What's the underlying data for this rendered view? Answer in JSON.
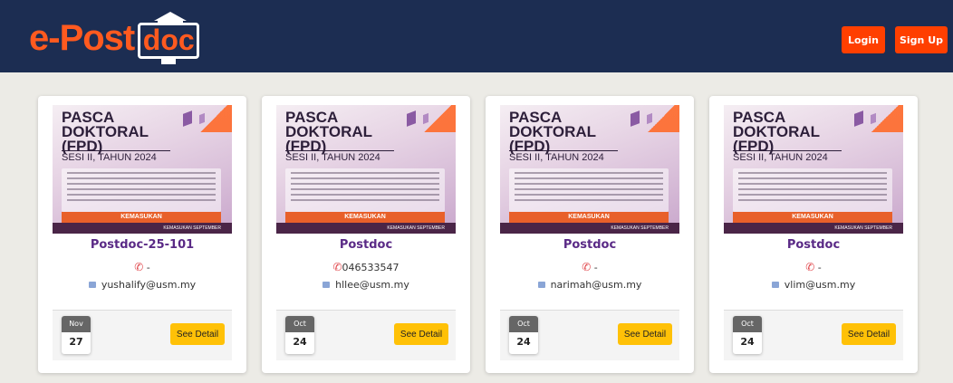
{
  "header": {
    "logo_text": "e-Post",
    "logo_doc": "doc",
    "login_label": "Login",
    "signup_label": "Sign Up"
  },
  "cards": [
    {
      "banner": {
        "title_line1": "PASCA",
        "title_line2": "DOKTORAL",
        "title_line3": "(FPD)",
        "session": "SESI II, TAHUN 2024",
        "kemasukan": "KEMASUKAN",
        "footer_text": "KEMASUKAN SEPTEMBER"
      },
      "title": "Postdoc-25-101",
      "phone": "-",
      "email": "yushalify@usm.my",
      "date_month": "Nov",
      "date_day": "27",
      "button_label": "See Detail"
    },
    {
      "banner": {
        "title_line1": "PASCA",
        "title_line2": "DOKTORAL",
        "title_line3": "(FPD)",
        "session": "SESI II, TAHUN 2024",
        "kemasukan": "KEMASUKAN",
        "footer_text": "KEMASUKAN SEPTEMBER"
      },
      "title": "Postdoc",
      "phone": "046533547",
      "email": "hllee@usm.my",
      "date_month": "Oct",
      "date_day": "24",
      "button_label": "See Detail"
    },
    {
      "banner": {
        "title_line1": "PASCA",
        "title_line2": "DOKTORAL",
        "title_line3": "(FPD)",
        "session": "SESI II, TAHUN 2024",
        "kemasukan": "KEMASUKAN",
        "footer_text": "KEMASUKAN SEPTEMBER"
      },
      "title": "Postdoc",
      "phone": "-",
      "email": "narimah@usm.my",
      "date_month": "Oct",
      "date_day": "24",
      "button_label": "See Detail"
    },
    {
      "banner": {
        "title_line1": "PASCA",
        "title_line2": "DOKTORAL",
        "title_line3": "(FPD)",
        "session": "SESI II, TAHUN 2024",
        "kemasukan": "KEMASUKAN",
        "footer_text": "KEMASUKAN SEPTEMBER"
      },
      "title": "Postdoc",
      "phone": "-",
      "email": "vlim@usm.my",
      "date_month": "Oct",
      "date_day": "24",
      "button_label": "See Detail"
    }
  ],
  "icons": {
    "phone": "phone-icon",
    "email": "email-icon"
  },
  "colors": {
    "header_bg": "#1c2d52",
    "brand_orange": "#ff5a1f",
    "nav_button": "#ff3f00",
    "detail_button": "#ffc107",
    "title_purple": "#5a2a86"
  }
}
